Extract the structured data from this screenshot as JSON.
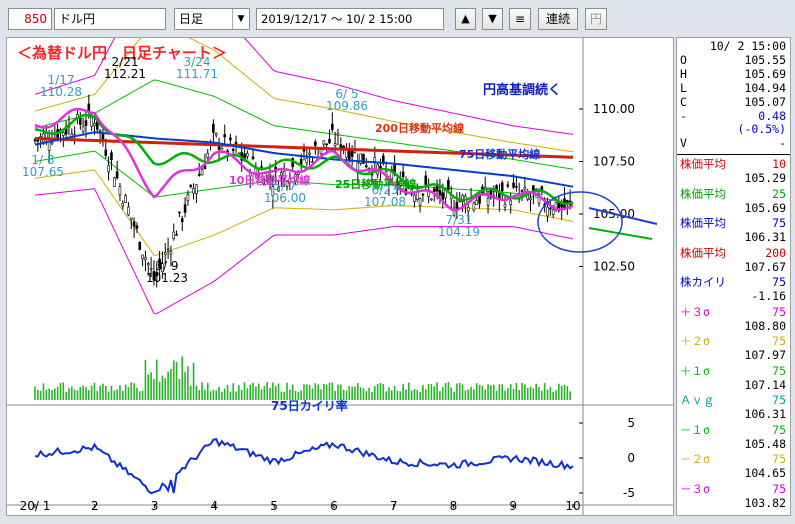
{
  "toolbar": {
    "code": "850",
    "name": "ドル円",
    "period": "日足",
    "date_range": "2019/12/17 ～ 10/ 2 15:00",
    "up_arrow": "▲",
    "down_arrow": "▼",
    "menu_icon": "≡",
    "continuous_button": "連続",
    "yen_button": "円"
  },
  "chart": {
    "title": "＜為替ドル円　日足チャート＞",
    "annotation_trend": "円高基調続く",
    "label_ma200": "200日移動平均線",
    "label_ma75": "75日移動平均線",
    "label_ma25": "25日移動平均線",
    "label_ma10": "10日移動平均線",
    "label_kairi": "75日カイリ率",
    "peaks": [
      {
        "date": "1/17",
        "value": "110.28"
      },
      {
        "date": "2/21",
        "value": "112.21"
      },
      {
        "date": "3/24",
        "value": "111.71"
      },
      {
        "date": "6/ 5",
        "value": "109.86"
      },
      {
        "date": "1/ 8",
        "value": "107.65"
      },
      {
        "date": "5/ 7",
        "value": "106.00"
      },
      {
        "date": "6/23",
        "value": "107.08"
      },
      {
        "date": "7/31",
        "value": "104.19"
      },
      {
        "date": "3/ 9",
        "value": "101.23"
      }
    ],
    "price_ticks": [
      "110.00",
      "107.50",
      "105.00",
      "102.50"
    ],
    "osc_ticks": [
      "5",
      "0",
      "-5"
    ],
    "x_ticks": [
      "20/ 1",
      "2",
      "3",
      "4",
      "5",
      "6",
      "7",
      "8",
      "9",
      "10"
    ]
  },
  "info": {
    "datetime": "10/ 2 15:00",
    "ohlc": [
      {
        "k": "O",
        "v": "105.55"
      },
      {
        "k": "H",
        "v": "105.69"
      },
      {
        "k": "L",
        "v": "104.94"
      },
      {
        "k": "C",
        "v": "105.07"
      }
    ],
    "change": "0.48",
    "change_pct": "(-0.5%)",
    "volume_label": "V",
    "volume": "-",
    "indicators": [
      {
        "label": "株価平均",
        "period": "10",
        "value": "105.29",
        "color": "#d80000"
      },
      {
        "label": "株価平均",
        "period": "25",
        "value": "105.69",
        "color": "#00a000"
      },
      {
        "label": "株価平均",
        "period": "75",
        "value": "106.31",
        "color": "#0000c8"
      },
      {
        "label": "株価平均",
        "period": "200",
        "value": "107.67",
        "color": "#c80000"
      },
      {
        "label": "株カイリ",
        "period": "75",
        "value": "-1.16",
        "color": "#0000c8"
      },
      {
        "label": "＋３σ",
        "period": "75",
        "value": "108.80",
        "color": "#e000e0"
      },
      {
        "label": "＋２σ",
        "period": "75",
        "value": "107.97",
        "color": "#d0b000"
      },
      {
        "label": "＋１σ",
        "period": "75",
        "value": "107.14",
        "color": "#00c000"
      },
      {
        "label": "Ａｖｇ",
        "period": "75",
        "value": "106.31",
        "color": "#00a0a0"
      },
      {
        "label": "－１σ",
        "period": "75",
        "value": "105.48",
        "color": "#00c000"
      },
      {
        "label": "－２σ",
        "period": "75",
        "value": "104.65",
        "color": "#d0b000"
      },
      {
        "label": "－３σ",
        "period": "75",
        "value": "103.82",
        "color": "#e000e0"
      }
    ]
  },
  "chart_data": {
    "type": "line",
    "x": [
      "20/ 1",
      "2",
      "3",
      "4",
      "5",
      "6",
      "7",
      "8",
      "9",
      "10"
    ],
    "ylim": [
      101.0,
      113.0
    ],
    "series": [
      {
        "name": "200日移動平均線",
        "values": [
          108.6,
          108.5,
          108.4,
          108.3,
          108.2,
          108.1,
          108.0,
          107.9,
          107.8,
          107.7
        ]
      },
      {
        "name": "75日移動平均線",
        "values": [
          108.3,
          108.9,
          108.6,
          108.4,
          107.9,
          107.6,
          107.4,
          107.1,
          106.8,
          106.3
        ]
      },
      {
        "name": "25日移動平均線",
        "values": [
          108.8,
          109.6,
          107.6,
          107.7,
          107.3,
          107.5,
          106.8,
          105.9,
          106.0,
          105.7
        ]
      },
      {
        "name": "10日移動平均線",
        "values": [
          109.2,
          110.0,
          106.0,
          107.9,
          106.8,
          107.8,
          106.5,
          105.4,
          106.0,
          105.3
        ]
      }
    ],
    "oscillator": {
      "name": "75日カイリ率",
      "ylim": [
        -6,
        6
      ],
      "values": [
        0.5,
        1.5,
        -5.0,
        2.5,
        -0.5,
        2.0,
        -0.5,
        -1.0,
        0.0,
        -1.16
      ]
    }
  }
}
